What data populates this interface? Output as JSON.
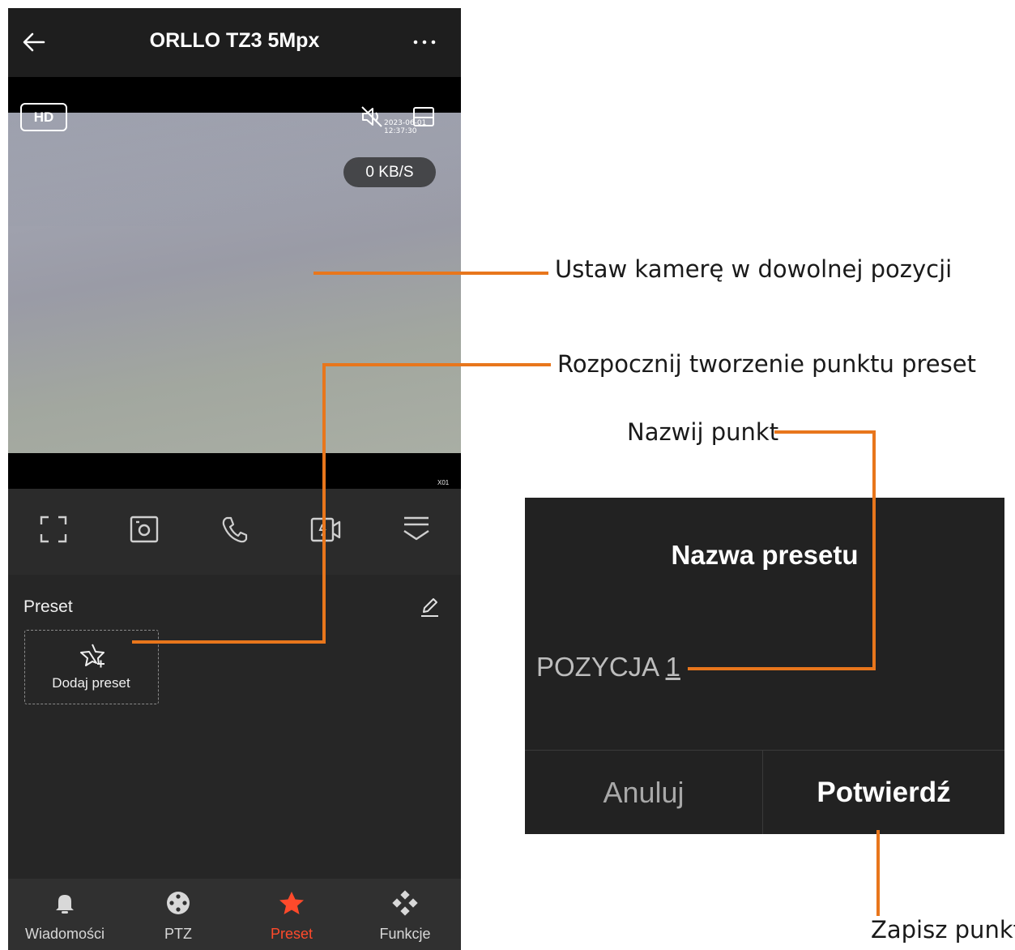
{
  "header": {
    "title": "ORLLO TZ3 5Mpx"
  },
  "video": {
    "quality_badge": "HD",
    "timestamp": "2023-06-01 12:37:30",
    "data_rate": "0 KB/S",
    "channel_label": "X01"
  },
  "controls": {
    "icons": [
      "fullscreen-icon",
      "snapshot-icon",
      "call-icon",
      "record-icon",
      "collapse-menu-icon"
    ]
  },
  "preset_section": {
    "title": "Preset",
    "add_label": "Dodaj preset"
  },
  "tabs": [
    {
      "label": "Wiadomości",
      "icon": "bell-icon",
      "active": false
    },
    {
      "label": "PTZ",
      "icon": "ptz-joystick-icon",
      "active": false
    },
    {
      "label": "Preset",
      "icon": "star-icon",
      "active": true
    },
    {
      "label": "Funkcje",
      "icon": "functions-icon",
      "active": false
    }
  ],
  "dialog": {
    "title": "Nazwa presetu",
    "input_prefix": "POZYCJA ",
    "input_suffix": "1",
    "cancel_label": "Anuluj",
    "confirm_label": "Potwierdź"
  },
  "annotations": {
    "set_camera": "Ustaw kamerę w dowolnej pozycji",
    "start_preset": "Rozpocznij tworzenie punktu preset",
    "name_point": "Nazwij punkt",
    "save_point": "Zapisz punkt"
  },
  "colors": {
    "accent_active_tab": "#ff4a2b",
    "annotation_line": "#e8761c"
  }
}
